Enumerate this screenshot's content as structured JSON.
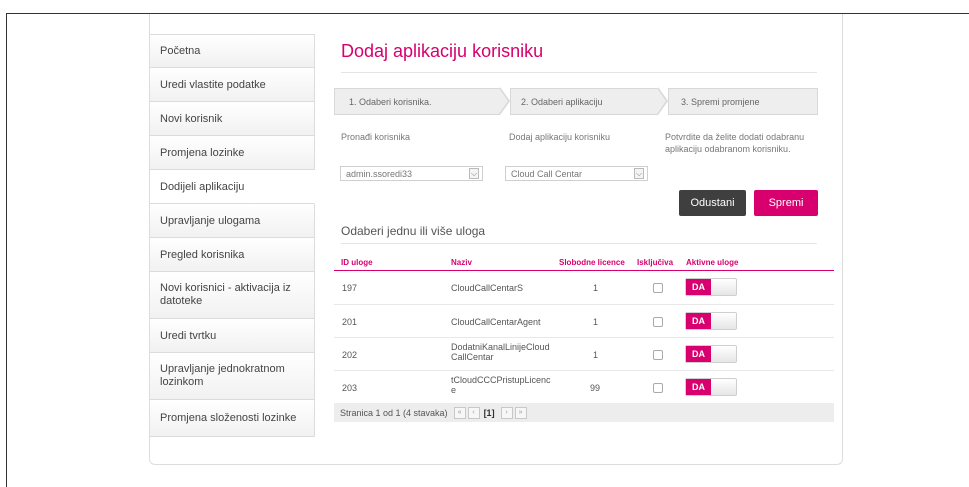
{
  "sidebar": {
    "items": [
      {
        "label": "Početna"
      },
      {
        "label": "Uredi vlastite podatke"
      },
      {
        "label": "Novi korisnik"
      },
      {
        "label": "Promjena lozinke"
      },
      {
        "label": "Dodijeli aplikaciju"
      },
      {
        "label": "Upravljanje ulogama"
      },
      {
        "label": "Pregled korisnika"
      },
      {
        "label": "Novi korisnici - aktivacija iz datoteke"
      },
      {
        "label": "Uredi tvrtku"
      },
      {
        "label": "Upravljanje jednokratnom lozinkom"
      },
      {
        "label": "Promjena složenosti lozinke"
      }
    ]
  },
  "page": {
    "title": "Dodaj aplikaciju korisniku"
  },
  "steps": [
    "1. Odaberi korisnika.",
    "2. Odaberi aplikaciju",
    "3. Spremi promjene"
  ],
  "form": {
    "find_user_label": "Pronađi korisnika",
    "add_app_label": "Dodaj aplikaciju korisniku",
    "confirm_text": "Potvrdite da želite dodati odabranu aplikaciju odabranom korisniku.",
    "user_value": "admin.ssoredi33",
    "app_value": "Cloud Call Centar",
    "cancel_label": "Odustani",
    "save_label": "Spremi"
  },
  "roles": {
    "heading": "Odaberi jednu ili više uloga",
    "columns": [
      "ID uloge",
      "Naziv",
      "Slobodne licence",
      "Isključiva",
      "Aktivne uloge"
    ],
    "rows": [
      {
        "id": "197",
        "name": "CloudCallCentarS",
        "licenses": "1",
        "toggle": "DA"
      },
      {
        "id": "201",
        "name": "CloudCallCentarAgent",
        "licenses": "1",
        "toggle": "DA"
      },
      {
        "id": "202",
        "name": "DodatniKanalLinijeCloud CallCentar",
        "licenses": "1",
        "toggle": "DA"
      },
      {
        "id": "203",
        "name": "tCloudCCCPristupLicenc e",
        "licenses": "99",
        "toggle": "DA"
      }
    ]
  },
  "pager": {
    "text": "Stranica 1 od 1 (4 stavaka)",
    "current": "[1]"
  },
  "colors": {
    "accent": "#d7006e",
    "dark_button": "#3f3f3f"
  },
  "icons": {
    "first": "double-left-icon",
    "prev": "left-icon",
    "next": "right-icon",
    "last": "double-right-icon",
    "dropdown": "chevron-down-icon"
  }
}
